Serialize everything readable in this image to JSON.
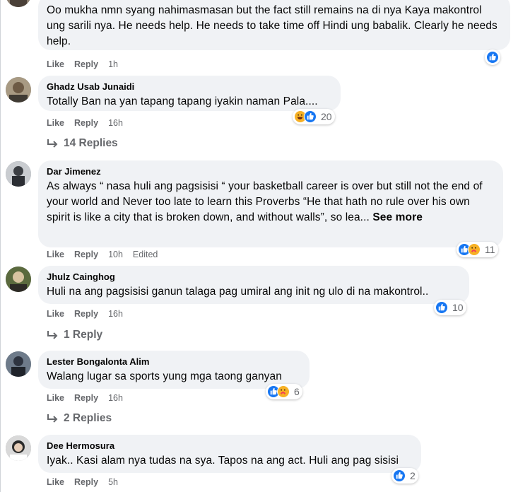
{
  "comments": [
    {
      "text": "Oo mukha nmn syang nahimasmasan but the fact still remains na di nya Kaya makontrol ung sarili nya. He needs help. He needs to take time off Hindi ung babalik. Clearly he needs help.",
      "like": "Like",
      "reply": "Reply",
      "time": "1h",
      "reactions": {
        "icons": [
          "like-icon"
        ],
        "count": ""
      }
    },
    {
      "author": "Ghadz Usab Junaidi",
      "text": "Totally Ban na yan tapang tapang iyakin naman Pala....",
      "like": "Like",
      "reply": "Reply",
      "time": "16h",
      "reactions": {
        "icons": [
          "haha-icon",
          "like-icon"
        ],
        "count": "20"
      },
      "replies": "14 Replies"
    },
    {
      "author": "Dar Jimenez",
      "text": "As always “ nasa huli ang pagsisisi “ your basketball career is over but still not the end of your world and Never too late to learn this Proverbs “He that hath no rule over his own spirit is like a city that is broken down, and without walls”, so lea...",
      "see_more": "See more",
      "like": "Like",
      "reply": "Reply",
      "time": "10h",
      "edited": "Edited",
      "reactions": {
        "icons": [
          "like-icon",
          "care-icon"
        ],
        "count": "11"
      }
    },
    {
      "author": "Jhulz Cainghog",
      "text": "Huli na ang pagsisisi ganun talaga pag umiral ang init ng ulo di na makontrol..",
      "like": "Like",
      "reply": "Reply",
      "time": "16h",
      "reactions": {
        "icons": [
          "like-icon"
        ],
        "count": "10"
      },
      "replies": "1 Reply"
    },
    {
      "author": "Lester Bongalonta Alim",
      "text": "Walang lugar sa sports yung mga taong ganyan",
      "like": "Like",
      "reply": "Reply",
      "time": "16h",
      "reactions": {
        "icons": [
          "like-icon",
          "care-icon"
        ],
        "count": "6"
      },
      "replies": "2 Replies"
    },
    {
      "author": "Dee Hermosura",
      "text": "Iyak.. Kasi alam nya tudas na sya. Tapos na ang act. Huli ang pag sisisi",
      "like": "Like",
      "reply": "Reply",
      "time": "5h",
      "reactions": {
        "icons": [
          "like-icon"
        ],
        "count": "2"
      }
    }
  ],
  "colors": {
    "bubble": "#f0f2f5",
    "meta": "#65676b",
    "like_blue": "#1877f2",
    "care_yellow": "#f7b125",
    "love_red": "#f33e58"
  }
}
